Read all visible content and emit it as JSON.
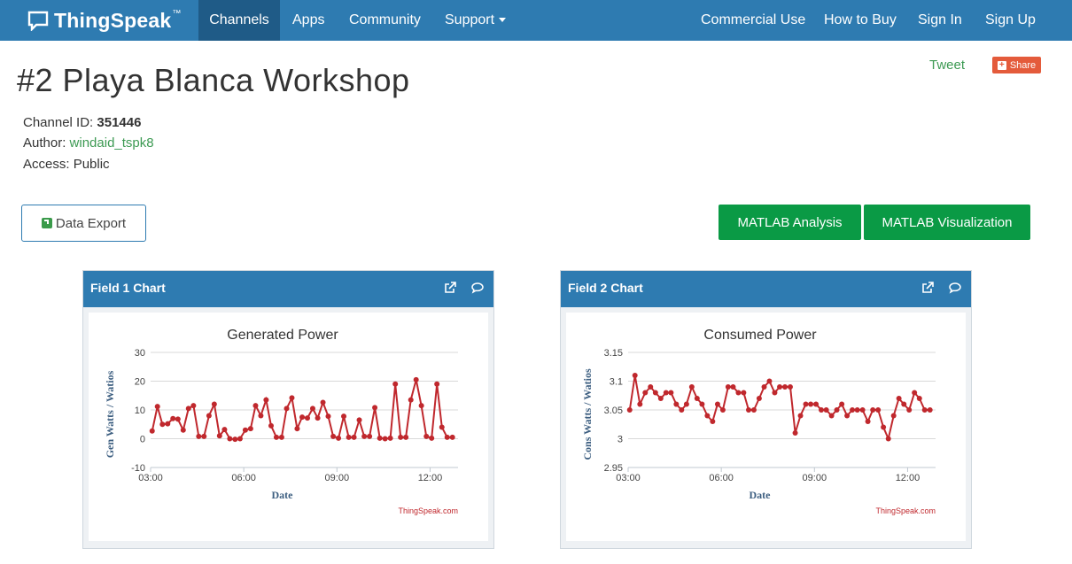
{
  "nav": {
    "brand": "ThingSpeak",
    "brand_tm": "™",
    "items": [
      "Channels",
      "Apps",
      "Community",
      "Support"
    ],
    "right_items": [
      "Commercial Use",
      "How to Buy",
      "Sign In",
      "Sign Up"
    ]
  },
  "channel": {
    "title": "#2 Playa Blanca Workshop",
    "id_label": "Channel ID:",
    "id_value": "351446",
    "author_label": "Author:",
    "author_value": "windaid_tspk8",
    "access_label": "Access:",
    "access_value": "Public"
  },
  "social": {
    "tweet": "Tweet",
    "share": "Share"
  },
  "buttons": {
    "export": "Data Export",
    "analysis": "MATLAB Analysis",
    "visualization": "MATLAB Visualization"
  },
  "colors": {
    "navbar": "#2e7bb1",
    "navbar_active": "#1f5b87",
    "green_button": "#0a9a45",
    "series": "#c0282d",
    "link_green": "#3d9a53"
  },
  "panels": [
    {
      "heading": "Field 1 Chart",
      "icons": [
        "external-link-icon",
        "comment-icon"
      ]
    },
    {
      "heading": "Field 2 Chart",
      "icons": [
        "external-link-icon",
        "comment-icon"
      ]
    }
  ],
  "chart_data": [
    {
      "type": "line",
      "title": "Generated Power",
      "xlabel": "Date",
      "ylabel": "Gen Watts / Watios",
      "credit": "ThingSpeak.com",
      "ylim": [
        -10,
        30
      ],
      "yticks": [
        -10,
        0,
        10,
        20,
        30
      ],
      "xlim": [
        3.0,
        12.9
      ],
      "xticks": [
        3,
        6,
        9,
        12
      ],
      "xtick_labels": [
        "03:00",
        "06:00",
        "09:00",
        "12:00"
      ],
      "grid": true,
      "legend": "none",
      "series": [
        {
          "x": [
            3.05,
            3.22,
            3.38,
            3.55,
            3.72,
            3.88,
            4.05,
            4.22,
            4.38,
            4.55,
            4.72,
            4.88,
            5.05,
            5.22,
            5.38,
            5.55,
            5.72,
            5.88,
            6.05,
            6.22,
            6.38,
            6.55,
            6.72,
            6.88,
            7.05,
            7.22,
            7.38,
            7.55,
            7.72,
            7.88,
            8.05,
            8.22,
            8.38,
            8.55,
            8.72,
            8.88,
            9.05,
            9.22,
            9.38,
            9.55,
            9.72,
            9.88,
            10.05,
            10.22,
            10.38,
            10.55,
            10.72,
            10.88,
            11.05,
            11.22,
            11.38,
            11.55,
            11.72,
            11.88,
            12.05,
            12.22,
            12.38,
            12.55,
            12.72
          ],
          "y": [
            2.7,
            11.2,
            5.0,
            5.2,
            7.0,
            6.8,
            3.0,
            10.5,
            11.5,
            0.8,
            0.8,
            8.0,
            12.0,
            1.0,
            3.2,
            0,
            -0.2,
            0,
            3.0,
            3.5,
            11.5,
            8.0,
            13.5,
            4.5,
            0.5,
            0.5,
            10.5,
            14.2,
            3.5,
            7.5,
            7.2,
            10.5,
            7.2,
            12.6,
            7.8,
            0.8,
            0.2,
            7.8,
            0.5,
            0.5,
            6.5,
            0.8,
            0.8,
            10.8,
            0.2,
            0,
            0.2,
            19.0,
            0.5,
            0.5,
            13.5,
            20.5,
            11.5,
            0.8,
            0.2,
            19.0,
            4.0,
            0.5,
            0.5
          ]
        }
      ]
    },
    {
      "type": "line",
      "title": "Consumed Power",
      "xlabel": "Date",
      "ylabel": "Cons Watts / Watios",
      "credit": "ThingSpeak.com",
      "ylim": [
        2.95,
        3.15
      ],
      "yticks": [
        2.95,
        3,
        3.05,
        3.1,
        3.15
      ],
      "xlim": [
        3.0,
        12.9
      ],
      "xticks": [
        3,
        6,
        9,
        12
      ],
      "xtick_labels": [
        "03:00",
        "06:00",
        "09:00",
        "12:00"
      ],
      "grid": true,
      "legend": "none",
      "series": [
        {
          "x": [
            3.05,
            3.22,
            3.38,
            3.55,
            3.72,
            3.88,
            4.05,
            4.22,
            4.38,
            4.55,
            4.72,
            4.88,
            5.05,
            5.22,
            5.38,
            5.55,
            5.72,
            5.88,
            6.05,
            6.22,
            6.38,
            6.55,
            6.72,
            6.88,
            7.05,
            7.22,
            7.38,
            7.55,
            7.72,
            7.88,
            8.05,
            8.22,
            8.38,
            8.55,
            8.72,
            8.88,
            9.05,
            9.22,
            9.38,
            9.55,
            9.72,
            9.88,
            10.05,
            10.22,
            10.38,
            10.55,
            10.72,
            10.88,
            11.05,
            11.22,
            11.38,
            11.55,
            11.72,
            11.88,
            12.05,
            12.22,
            12.38,
            12.55,
            12.72
          ],
          "y": [
            3.05,
            3.11,
            3.06,
            3.08,
            3.09,
            3.08,
            3.07,
            3.08,
            3.08,
            3.06,
            3.05,
            3.06,
            3.09,
            3.07,
            3.06,
            3.04,
            3.03,
            3.06,
            3.05,
            3.09,
            3.09,
            3.08,
            3.08,
            3.05,
            3.05,
            3.07,
            3.09,
            3.1,
            3.08,
            3.09,
            3.09,
            3.09,
            3.01,
            3.04,
            3.06,
            3.06,
            3.06,
            3.05,
            3.05,
            3.04,
            3.05,
            3.06,
            3.04,
            3.05,
            3.05,
            3.05,
            3.03,
            3.05,
            3.05,
            3.02,
            3.0,
            3.04,
            3.07,
            3.06,
            3.05,
            3.08,
            3.07,
            3.05,
            3.05
          ]
        }
      ]
    }
  ]
}
